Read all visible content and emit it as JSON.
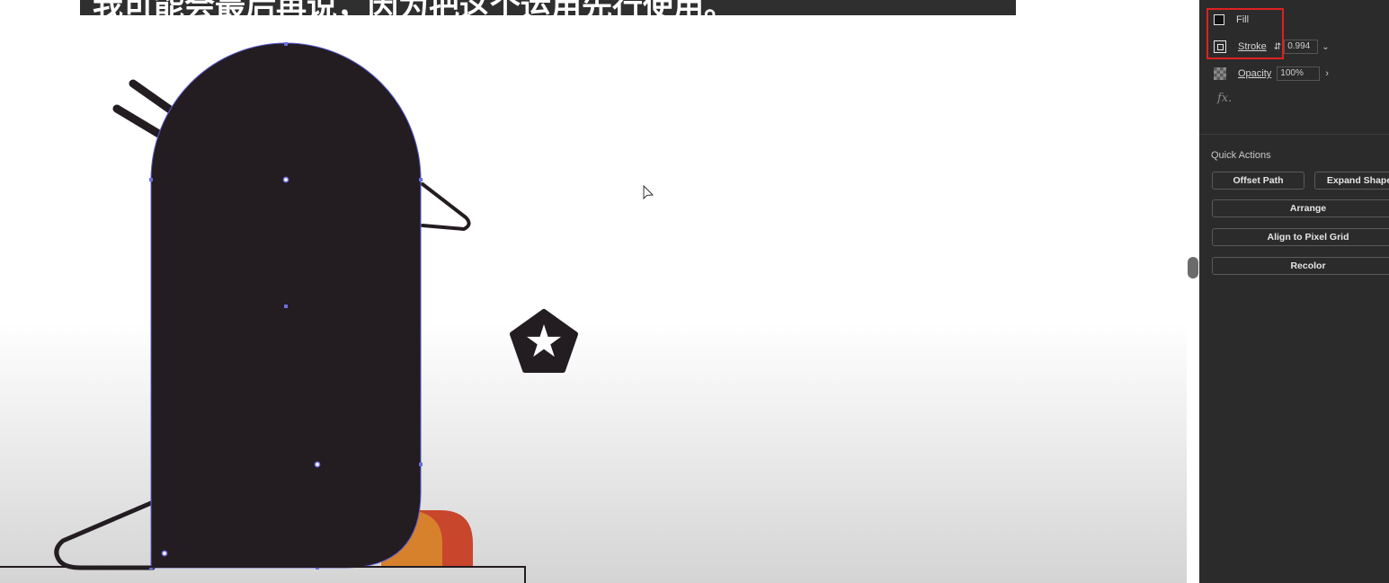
{
  "caption": "我可能会最后再说，因为把这个运用先行使用。",
  "appearance": {
    "fill_label": "Fill",
    "stroke_label": "Stroke",
    "stroke_value": "0.994",
    "opacity_label": "Opacity",
    "opacity_value": "100%",
    "fx_label": "fx."
  },
  "quick_actions": {
    "title": "Quick Actions",
    "offset_path": "Offset Path",
    "expand_shape": "Expand Shape",
    "arrange": "Arrange",
    "align_pixel_grid": "Align to Pixel Grid",
    "recolor": "Recolor"
  },
  "icons": {
    "stroke_spinner": "up-down-chevron-icon",
    "stroke_dropdown": "chevron-down-icon",
    "opacity_more": "chevron-right-icon",
    "cursor": "arrow-cursor-icon",
    "star_badge": "pentagon-star-icon"
  },
  "colors": {
    "character_body": "#231c21",
    "selection": "#5c5fd6",
    "foot_orange": "#d7812c",
    "foot_red": "#c8462c",
    "highlight": "#e02020",
    "panel_bg": "#2b2b2b"
  }
}
